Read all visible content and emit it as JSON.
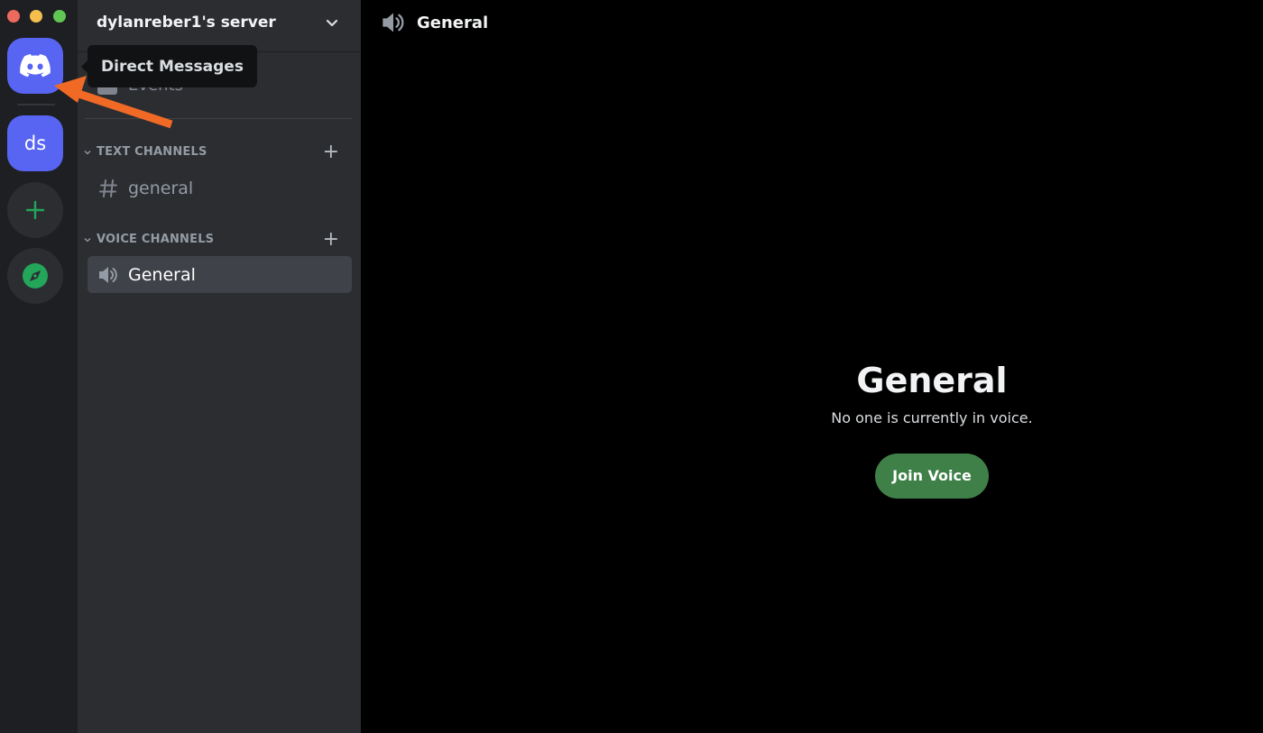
{
  "window": {
    "traffic_lights": [
      "close",
      "minimize",
      "maximize"
    ]
  },
  "server_rail": {
    "home": {
      "icon": "discord-logo-icon",
      "tooltip": "Direct Messages",
      "color": "#5865f2"
    },
    "servers": [
      {
        "label": "ds",
        "color": "#5865f2"
      }
    ],
    "add_server": {
      "icon": "plus-icon",
      "color": "#23a55a"
    },
    "explore": {
      "icon": "compass-icon",
      "color": "#23a55a"
    }
  },
  "channel_list": {
    "server_name": "dylanreber1's server",
    "events_label": "Events",
    "categories": [
      {
        "name": "TEXT CHANNELS",
        "channels": [
          {
            "type": "text",
            "name": "general",
            "selected": false
          }
        ]
      },
      {
        "name": "VOICE CHANNELS",
        "channels": [
          {
            "type": "voice",
            "name": "General",
            "selected": true
          }
        ]
      }
    ]
  },
  "main": {
    "header_title": "General",
    "voice_title": "General",
    "voice_status": "No one is currently in voice.",
    "join_button": "Join Voice",
    "join_color": "#3f8048"
  },
  "annotation": {
    "type": "arrow",
    "color": "#f06a25",
    "points_to": "Direct Messages"
  }
}
